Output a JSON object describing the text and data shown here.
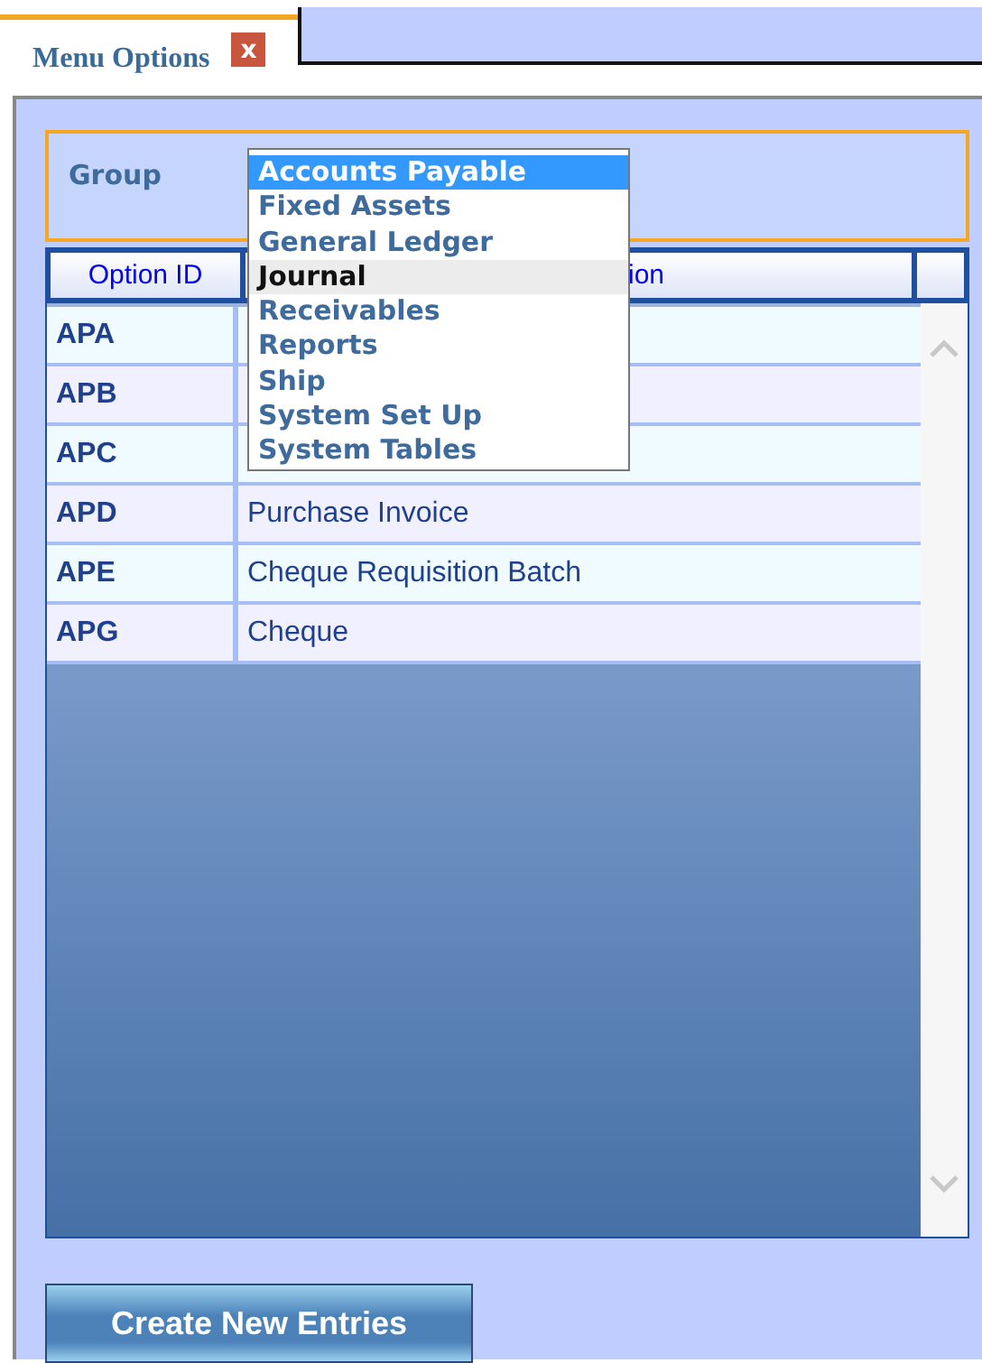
{
  "tabs": [
    {
      "label": "Menu Options",
      "selected": true,
      "close": "x"
    }
  ],
  "group": {
    "label": "Group",
    "dropdown_options": [
      {
        "label": "Accounts Payable",
        "selected": true,
        "hovered": false
      },
      {
        "label": "Fixed Assets",
        "selected": false,
        "hovered": false
      },
      {
        "label": "General Ledger",
        "selected": false,
        "hovered": false
      },
      {
        "label": "Journal",
        "selected": false,
        "hovered": true
      },
      {
        "label": "Receivables",
        "selected": false,
        "hovered": false
      },
      {
        "label": "Reports",
        "selected": false,
        "hovered": false
      },
      {
        "label": "Ship",
        "selected": false,
        "hovered": false
      },
      {
        "label": "System Set Up",
        "selected": false,
        "hovered": false
      },
      {
        "label": "System Tables",
        "selected": false,
        "hovered": false
      }
    ]
  },
  "table": {
    "columns": [
      "Option ID",
      "ion"
    ],
    "rows": [
      {
        "id": "APA"
      },
      {
        "id": "APB"
      },
      {
        "id": "APC"
      },
      {
        "id": "APD",
        "description": "Purchase Invoice"
      },
      {
        "id": "APE",
        "description": "Cheque Requisition Batch"
      },
      {
        "id": "APG",
        "description": "Cheque"
      }
    ]
  },
  "buttons": [
    "Create New Entries"
  ]
}
